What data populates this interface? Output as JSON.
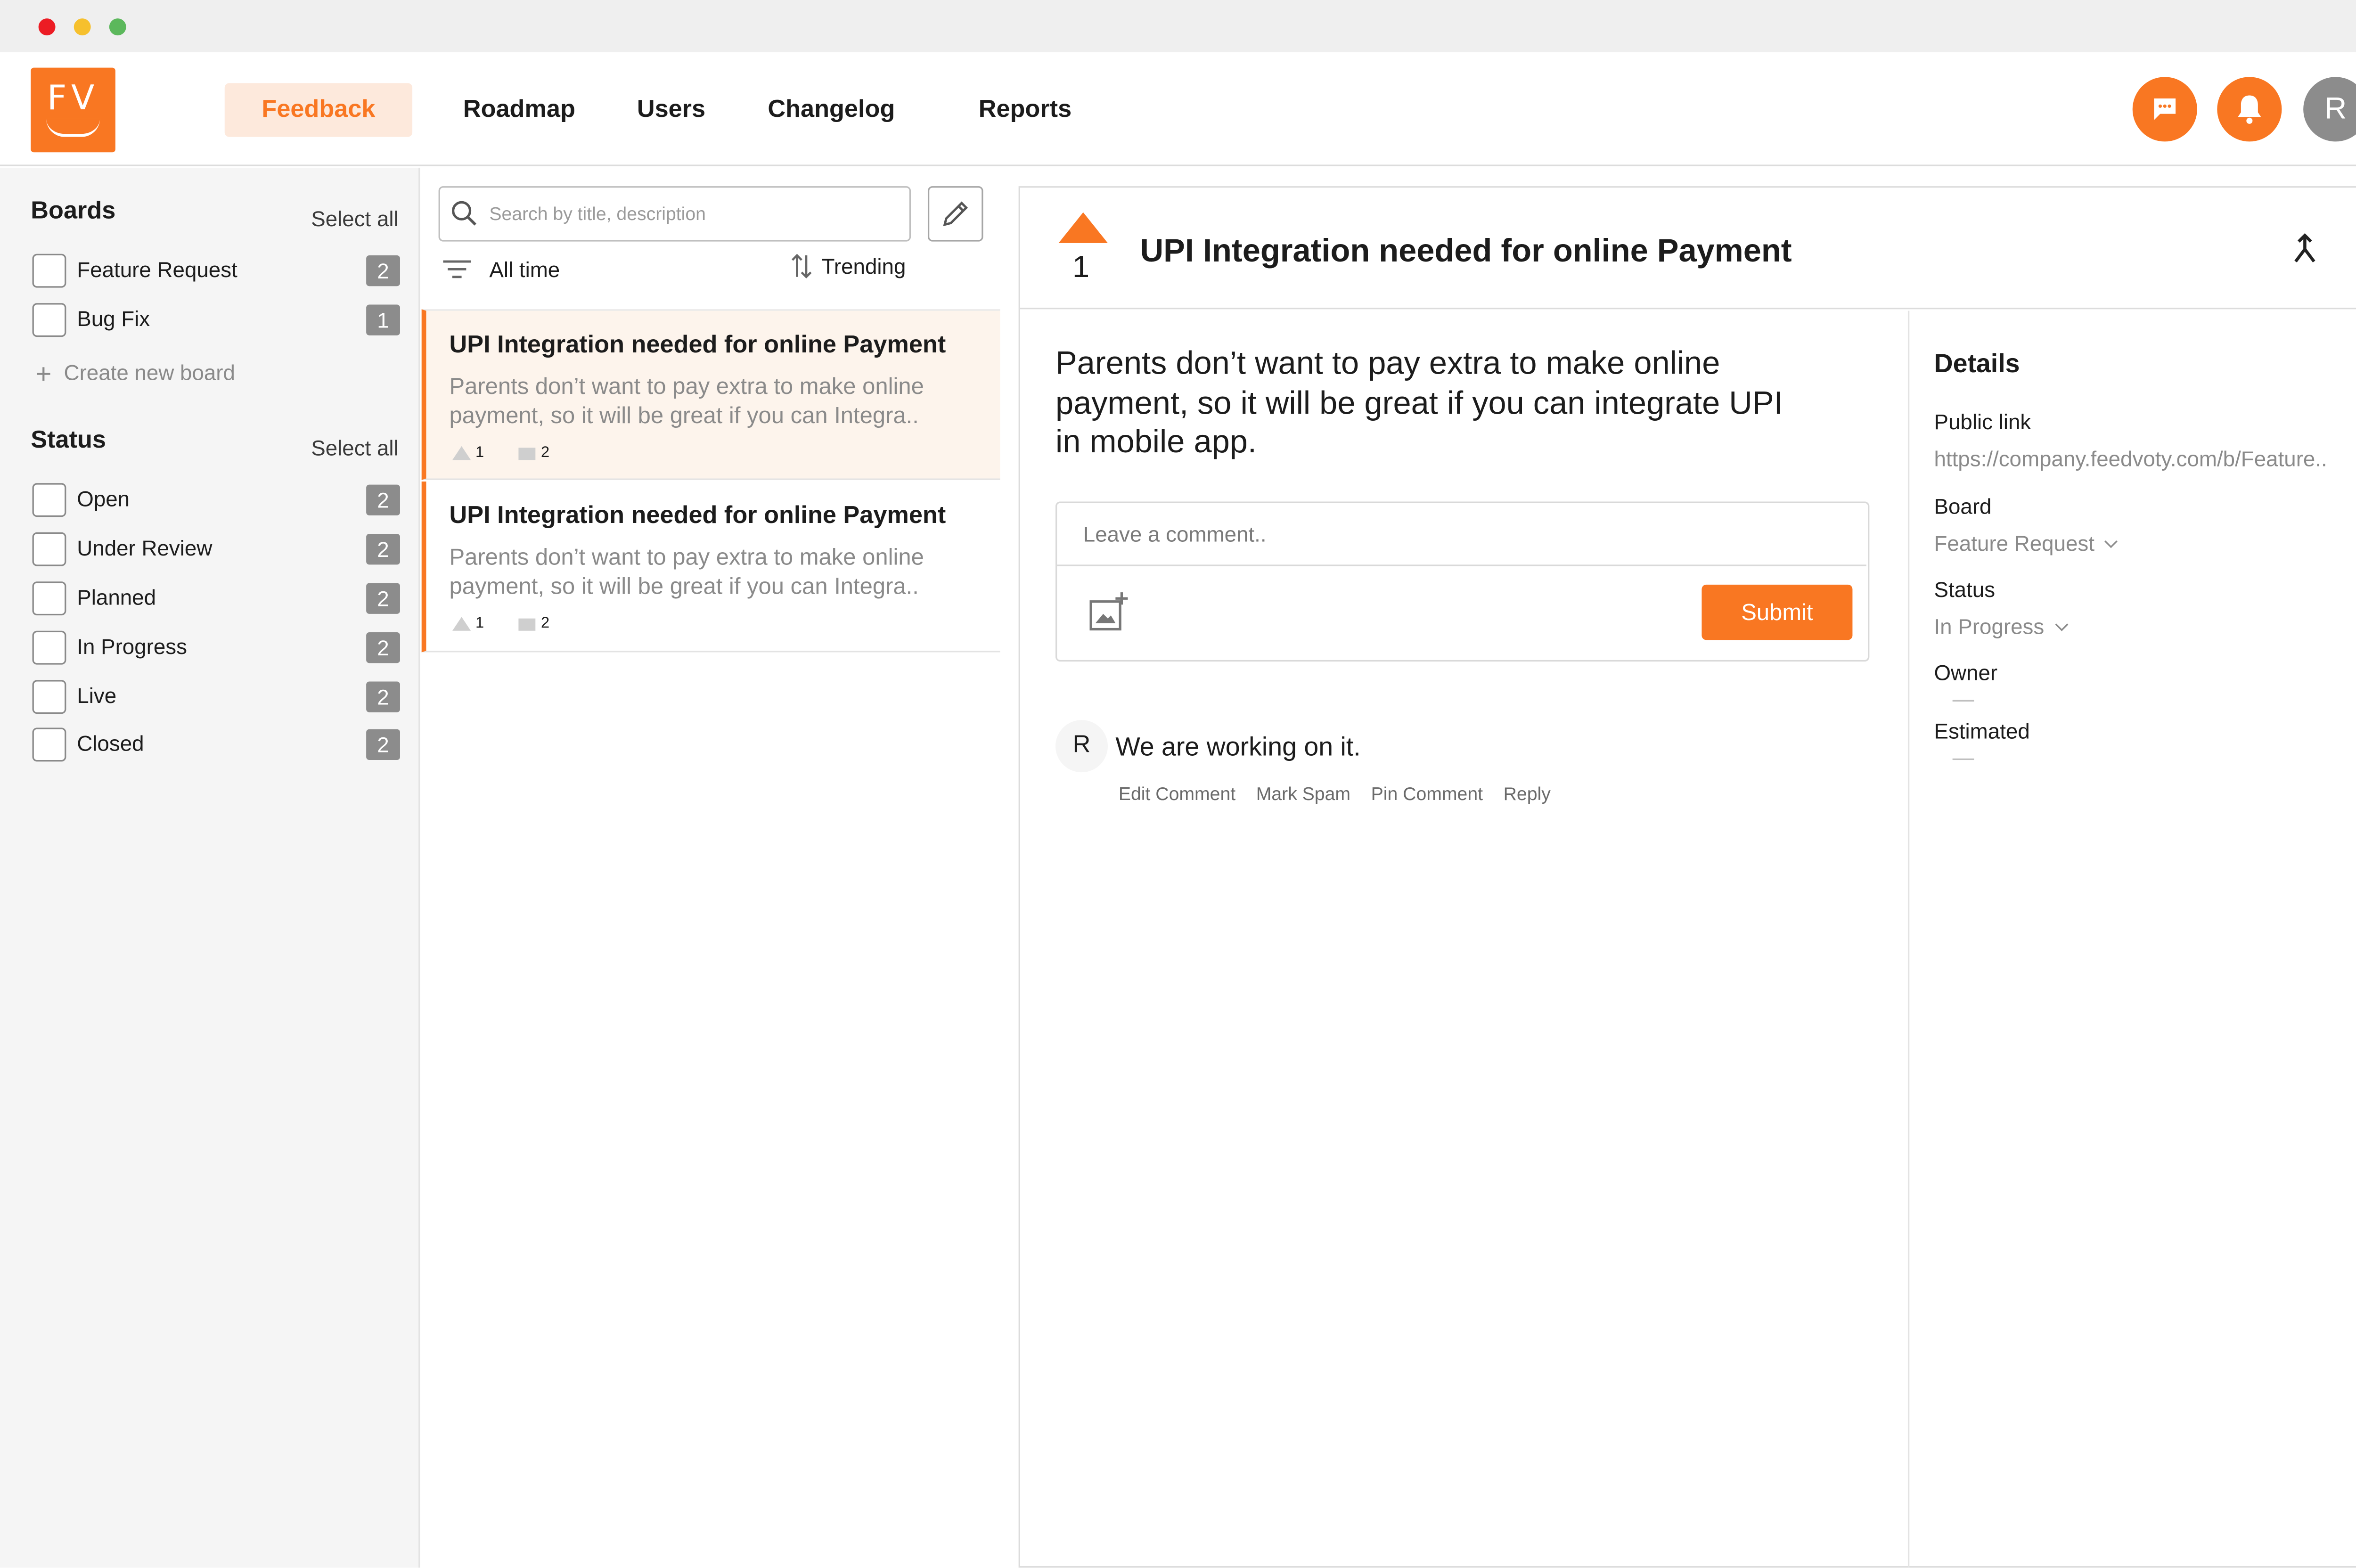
{
  "nav": {
    "logo_text": "FV",
    "items": [
      "Feedback",
      "Roadmap",
      "Users",
      "Changelog",
      "Reports"
    ],
    "active": "Feedback",
    "avatar_initial": "R",
    "icons": [
      "chat-icon",
      "bell-icon"
    ]
  },
  "sidebar": {
    "boards_title": "Boards",
    "boards_select_all": "Select all",
    "boards": [
      {
        "label": "Feature Request",
        "count": "2"
      },
      {
        "label": "Bug Fix",
        "count": "1"
      }
    ],
    "create_board": "Create new board",
    "status_title": "Status",
    "status_select_all": "Select all",
    "statuses": [
      {
        "label": "Open",
        "count": "2"
      },
      {
        "label": "Under Review",
        "count": "2"
      },
      {
        "label": "Planned",
        "count": "2"
      },
      {
        "label": "In Progress",
        "count": "2"
      },
      {
        "label": "Live",
        "count": "2"
      },
      {
        "label": "Closed",
        "count": "2"
      }
    ]
  },
  "list": {
    "search_placeholder": "Search by title, description",
    "filter_label": "All time",
    "sort_label": "Trending",
    "posts": [
      {
        "title": "UPI Integration needed for online Payment",
        "desc_line1": "Parents don’t want to pay extra to make online",
        "desc_line2": "payment, so it will be great if you can Integra..",
        "votes": "1",
        "comments": "2"
      },
      {
        "title": "UPI Integration needed for online Payment",
        "desc_line1": "Parents don’t want to pay extra to make online",
        "desc_line2": "payment, so it will be great if you can Integra..",
        "votes": "1",
        "comments": "2"
      }
    ]
  },
  "detail": {
    "votes": "1",
    "title": "UPI Integration needed for online Payment",
    "body_line1": "Parents don’t want to pay extra to make online",
    "body_line2": "payment, so it will be great if you can integrate UPI",
    "body_line3": "in mobile app.",
    "comment_placeholder": "Leave a comment..",
    "submit_label": "Submit",
    "comment": {
      "author_initial": "R",
      "text": "We are working on it.",
      "actions": [
        "Edit Comment",
        "Mark Spam",
        "Pin Comment",
        "Reply"
      ]
    }
  },
  "details": {
    "title": "Details",
    "public_link_label": "Public link",
    "public_link_value": "https://company.feedvoty.com/b/Feature..",
    "board_label": "Board",
    "board_value": "Feature Request",
    "status_label": "Status",
    "status_value": "In Progress",
    "owner_label": "Owner",
    "estimated_label": "Estimated"
  },
  "colors": {
    "accent": "#f97722",
    "accent_light": "#fde9dc",
    "badge": "#8c8c8c"
  }
}
